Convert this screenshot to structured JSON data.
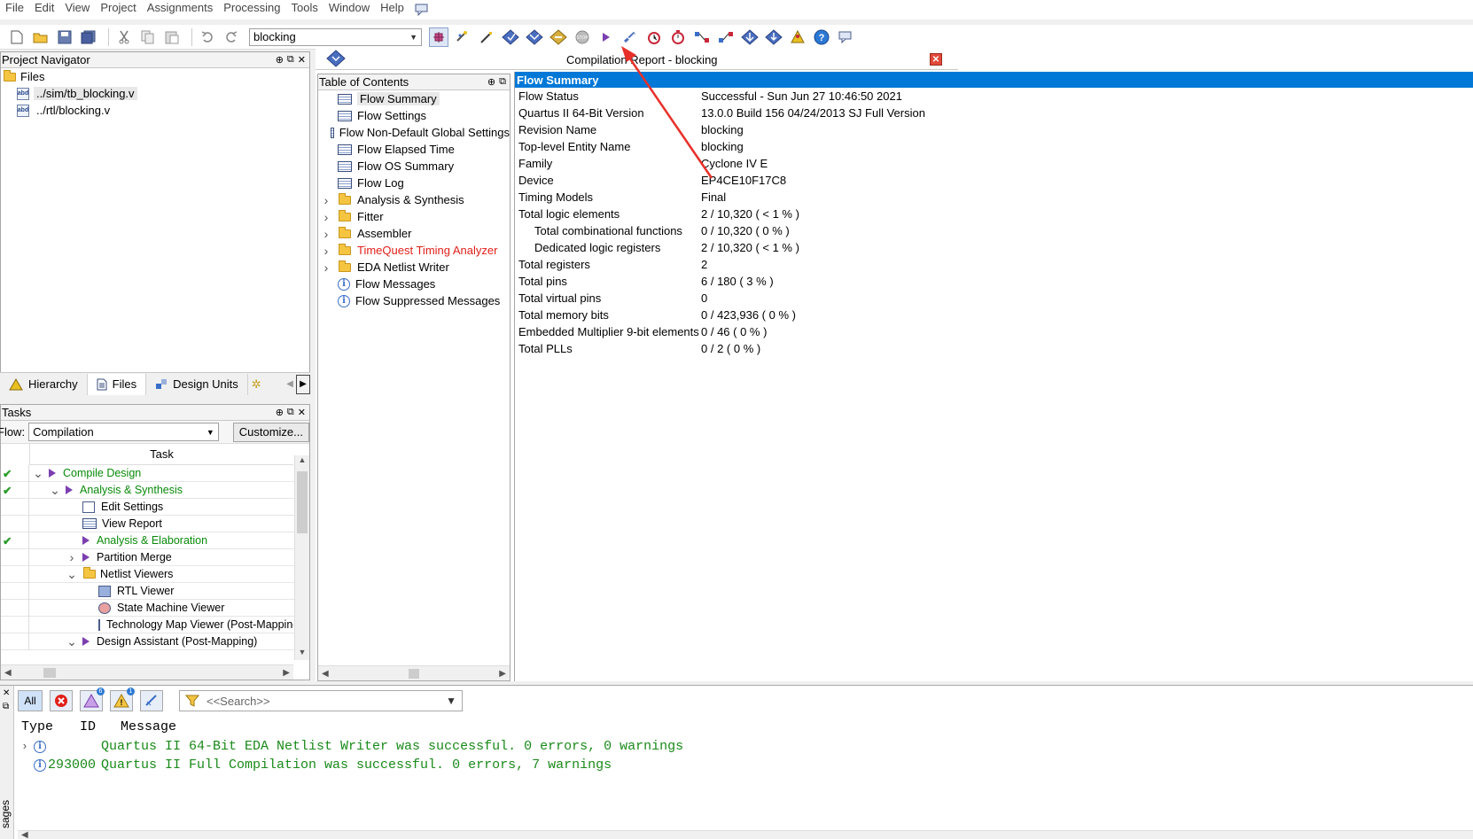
{
  "menu": [
    "File",
    "Edit",
    "View",
    "Project",
    "Assignments",
    "Processing",
    "Tools",
    "Window",
    "Help"
  ],
  "toolbar": {
    "revision": "blocking"
  },
  "nav": {
    "title": "Project Navigator",
    "files_root": "Files",
    "files": [
      "../sim/tb_blocking.v",
      "../rtl/blocking.v"
    ],
    "tabs": [
      "Hierarchy",
      "Files",
      "Design Units"
    ]
  },
  "tasks": {
    "title": "Tasks",
    "flow_label": "Flow:",
    "flow_value": "Compilation",
    "customize": "Customize...",
    "col_header": "Task",
    "rows": [
      {
        "label": "Compile Design",
        "done": true
      },
      {
        "label": "Analysis & Synthesis",
        "done": true
      },
      {
        "label": "Edit Settings",
        "done": false
      },
      {
        "label": "View Report",
        "done": false
      },
      {
        "label": "Analysis & Elaboration",
        "done": true
      },
      {
        "label": "Partition Merge",
        "done": false
      },
      {
        "label": "Netlist Viewers",
        "done": false
      },
      {
        "label": "RTL Viewer",
        "done": false
      },
      {
        "label": "State Machine Viewer",
        "done": false
      },
      {
        "label": "Technology Map Viewer (Post-Mapping)",
        "done": false
      },
      {
        "label": "Design Assistant (Post-Mapping)",
        "done": false
      }
    ]
  },
  "report": {
    "title": "Compilation Report - blocking",
    "toc_title": "Table of Contents",
    "toc": [
      "Flow Summary",
      "Flow Settings",
      "Flow Non-Default Global Settings",
      "Flow Elapsed Time",
      "Flow OS Summary",
      "Flow Log",
      "Analysis & Synthesis",
      "Fitter",
      "Assembler",
      "TimeQuest Timing Analyzer",
      "EDA Netlist Writer",
      "Flow Messages",
      "Flow Suppressed Messages"
    ],
    "summary_title": "Flow Summary",
    "summary": [
      [
        "Flow Status",
        "Successful - Sun Jun 27 10:46:50 2021"
      ],
      [
        "Quartus II 64-Bit Version",
        "13.0.0 Build 156 04/24/2013 SJ Full Version"
      ],
      [
        "Revision Name",
        "blocking"
      ],
      [
        "Top-level Entity Name",
        "blocking"
      ],
      [
        "Family",
        "Cyclone IV E"
      ],
      [
        "Device",
        "EP4CE10F17C8"
      ],
      [
        "Timing Models",
        "Final"
      ],
      [
        "Total logic elements",
        "2 / 10,320 ( < 1 % )"
      ],
      [
        "Total combinational functions",
        "0 / 10,320 ( 0 % )"
      ],
      [
        "Dedicated logic registers",
        "2 / 10,320 ( < 1 % )"
      ],
      [
        "Total registers",
        "2"
      ],
      [
        "Total pins",
        "6 / 180 ( 3 % )"
      ],
      [
        "Total virtual pins",
        "0"
      ],
      [
        "Total memory bits",
        "0 / 423,936 ( 0 % )"
      ],
      [
        "Embedded Multiplier 9-bit elements",
        "0 / 46 ( 0 % )"
      ],
      [
        "Total PLLs",
        "0 / 2 ( 0 % )"
      ]
    ]
  },
  "messages": {
    "filter_all": "All",
    "badge_warn": "6",
    "badge_crit": "1",
    "search_placeholder": "<<Search>>",
    "col_type": "Type",
    "col_id": "ID",
    "col_message": "Message",
    "side_label": "sages",
    "rows": [
      {
        "id": "",
        "text": "Quartus II 64-Bit EDA Netlist Writer was successful. 0 errors, 0 warnings"
      },
      {
        "id": "293000",
        "text": "Quartus II Full Compilation was successful. 0 errors, 7 warnings"
      }
    ]
  },
  "colors": {
    "accent": "#0078d7",
    "success": "#0a8a0a",
    "error": "#e0201a",
    "arrow": "#e8302a"
  }
}
